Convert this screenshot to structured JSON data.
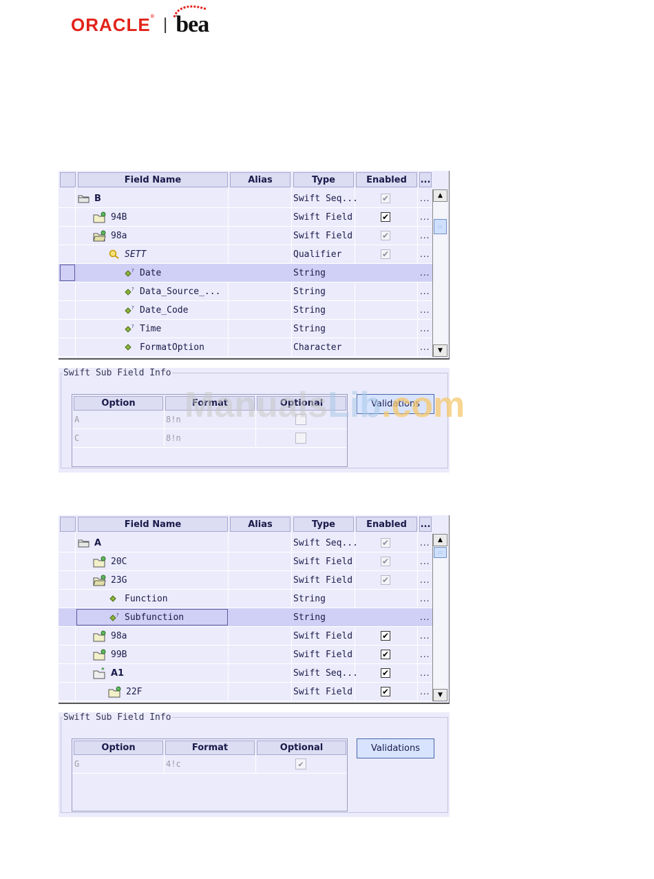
{
  "logo": {
    "oracle": "ORACLE",
    "bea": "bea"
  },
  "watermark": {
    "part1": "Manuals",
    "part2": "Lib",
    "part3": ".com"
  },
  "panel1": {
    "headers": {
      "field_name": "Field Name",
      "alias": "Alias",
      "type": "Type",
      "enabled": "Enabled",
      "more": "..."
    },
    "rows": [
      {
        "name": "B",
        "type": "Swift Seq...",
        "more": "..."
      },
      {
        "name": "94B",
        "type": "Swift Field",
        "more": "..."
      },
      {
        "name": "98a",
        "type": "Swift Field",
        "more": "..."
      },
      {
        "name": "SETT",
        "type": "Qualifier",
        "more": "..."
      },
      {
        "name": "Date",
        "type": "String",
        "more": "..."
      },
      {
        "name": "Data_Source_...",
        "type": "String",
        "more": "..."
      },
      {
        "name": "Date_Code",
        "type": "String",
        "more": "..."
      },
      {
        "name": "Time",
        "type": "String",
        "more": "..."
      },
      {
        "name": "FormatOption",
        "type": "Character",
        "more": "..."
      }
    ],
    "sub_info": {
      "legend": "Swift Sub Field Info",
      "headers": {
        "option": "Option",
        "format": "Format",
        "optional": "Optional"
      },
      "rows": [
        {
          "option": "A",
          "format": "8!n"
        },
        {
          "option": "C",
          "format": "8!n"
        }
      ],
      "validations": "Validations"
    }
  },
  "panel2": {
    "headers": {
      "field_name": "Field Name",
      "alias": "Alias",
      "type": "Type",
      "enabled": "Enabled",
      "more": "..."
    },
    "rows": [
      {
        "name": "A",
        "type": "Swift Seq...",
        "more": "..."
      },
      {
        "name": "20C",
        "type": "Swift Field",
        "more": "..."
      },
      {
        "name": "23G",
        "type": "Swift Field",
        "more": "..."
      },
      {
        "name": "Function",
        "type": "String",
        "more": "..."
      },
      {
        "name": "Subfunction",
        "type": "String",
        "more": "..."
      },
      {
        "name": "98a",
        "type": "Swift Field",
        "more": "..."
      },
      {
        "name": "99B",
        "type": "Swift Field",
        "more": "..."
      },
      {
        "name": "A1",
        "type": "Swift Seq...",
        "more": "..."
      },
      {
        "name": "22F",
        "type": "Swift Field",
        "more": "..."
      }
    ],
    "sub_info": {
      "legend": "Swift Sub Field Info",
      "headers": {
        "option": "Option",
        "format": "Format",
        "optional": "Optional"
      },
      "rows": [
        {
          "option": "G",
          "format": "4!c"
        }
      ],
      "validations": "Validations"
    }
  }
}
